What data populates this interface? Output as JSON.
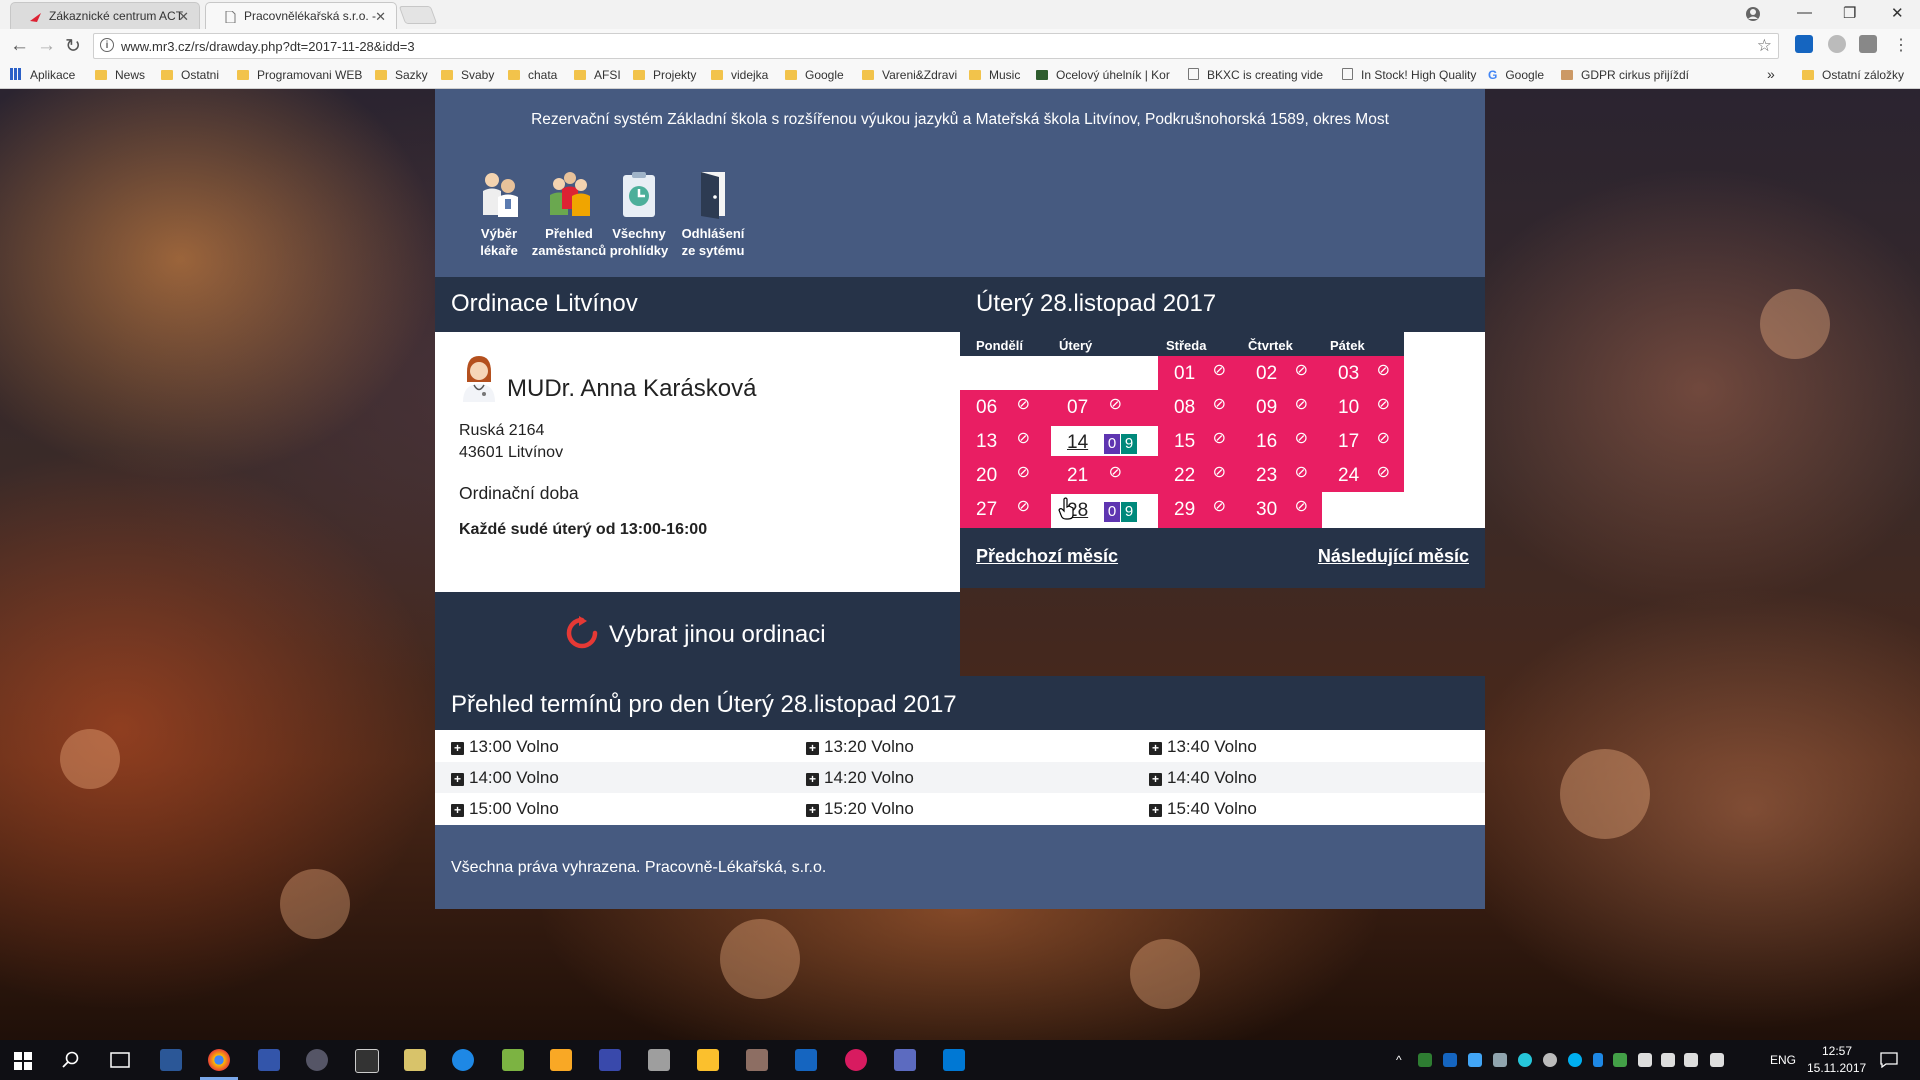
{
  "browser": {
    "tabs": [
      {
        "title": "Zákaznické centrum ACT",
        "close": "✕"
      },
      {
        "title": "Pracovnělékařská s.r.o. -",
        "close": "✕"
      }
    ],
    "url": "www.mr3.cz/rs/drawday.php?dt=2017-11-28&idd=3",
    "bookmarks": [
      "Aplikace",
      "News",
      "Ostatni",
      "Programovani WEB",
      "Sazky",
      "Svaby",
      "chata",
      "AFSI",
      "Projekty",
      "videjka",
      "Google",
      "Vareni&Zdravi",
      "Music",
      "Ocelový úhelník | Kor",
      "BKXC is creating vide",
      "In Stock! High Quality",
      "Google",
      "GDPR cirkus přijíždí",
      "Ostatní záložky"
    ],
    "more": "»"
  },
  "header": {
    "title": "Rezervační systém Základní škola s rozšířenou výukou jazyků a Mateřská škola Litvínov, Podkrušnohorská 1589, okres Most",
    "menu": [
      {
        "line1": "Výběr",
        "line2": "lékaře"
      },
      {
        "line1": "Přehled",
        "line2": "zaměstanců"
      },
      {
        "line1": "Všechny",
        "line2": "prohlídky"
      },
      {
        "line1": "Odhlášení",
        "line2": "ze sytému"
      }
    ]
  },
  "office": {
    "title": "Ordinace Litvínov",
    "doctor": "MUDr. Anna Karásková",
    "street": "Ruská 2164",
    "city": "43601 Litvínov",
    "hours_label": "Ordinační doba",
    "hours": "Každé sudé úterý od 13:00-16:00",
    "change_label": "Vybrat jinou ordinaci"
  },
  "calendar": {
    "title": "Úterý 28.listopad 2017",
    "days": [
      "Pondělí",
      "Úterý",
      "Středa",
      "Čtvrtek",
      "Pátek"
    ],
    "no_symbol": "⊘",
    "slot_counts": [
      "0",
      "9"
    ],
    "rows": [
      [
        "",
        "",
        "01",
        "02",
        "03"
      ],
      [
        "06",
        "07",
        "08",
        "09",
        "10"
      ],
      [
        "13",
        "14",
        "15",
        "16",
        "17"
      ],
      [
        "20",
        "21",
        "22",
        "23",
        "24"
      ],
      [
        "27",
        "28",
        "29",
        "30",
        ""
      ]
    ],
    "prev": "Předchozí měsíc",
    "next": "Následující měsíc"
  },
  "schedule": {
    "title": "Přehled termínů pro den Úterý 28.listopad 2017",
    "plus": "+",
    "slots": [
      [
        "13:00 Volno",
        "13:20 Volno",
        "13:40 Volno"
      ],
      [
        "14:00 Volno",
        "14:20 Volno",
        "14:40 Volno"
      ],
      [
        "15:00 Volno",
        "15:20 Volno",
        "15:40 Volno"
      ]
    ]
  },
  "footer": {
    "text": "Všechna práva vyhrazena. Pracovně-Lékařská, s.r.o."
  },
  "taskbar": {
    "lang": "ENG",
    "time": "12:57",
    "date": "15.11.2017"
  },
  "colors": {
    "header_bg": "#465a80",
    "dark_bg": "#263348",
    "accent_pink": "#e91e63",
    "slot_purple": "#5e35b1",
    "slot_teal": "#00897b"
  }
}
